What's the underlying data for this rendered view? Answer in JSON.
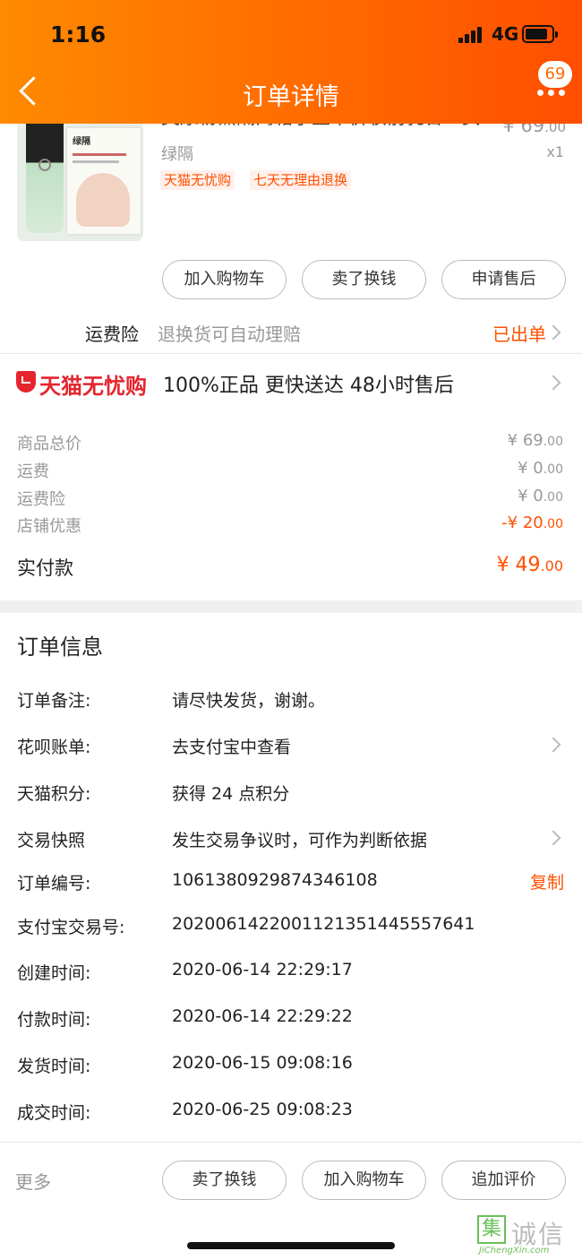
{
  "status_bar": {
    "time": "1:16",
    "network": "4G"
  },
  "header": {
    "title": "订单详情",
    "badge_count": "69"
  },
  "product": {
    "name": "美康粉黛隔离霜学生平价妆前乳合一女",
    "price_symbol": "¥",
    "price_int": "69",
    "price_dec": ".00",
    "sku": "绿隔",
    "qty": "x1",
    "tags": [
      "天猫无忧购",
      "七天无理由退换"
    ],
    "image_label": "绿隔"
  },
  "product_actions": [
    "加入购物车",
    "卖了换钱",
    "申请售后"
  ],
  "shipping_insurance": {
    "label": "运费险",
    "desc": "退换货可自动理赔",
    "status": "已出单"
  },
  "tmall_guarantee": {
    "brand": "天猫无忧购",
    "promise": "100%正品  更快送达  48小时售后"
  },
  "fees": [
    {
      "label": "商品总价",
      "value": "¥ 69",
      "dec": ".00",
      "highlight": false
    },
    {
      "label": "运费",
      "value": "¥ 0",
      "dec": ".00",
      "highlight": false
    },
    {
      "label": "运费险",
      "value": "¥ 0",
      "dec": ".00",
      "highlight": false
    },
    {
      "label": "店铺优惠",
      "value": "-¥ 20",
      "dec": ".00",
      "highlight": true
    }
  ],
  "actual_paid": {
    "label": "实付款",
    "value": "¥ 49",
    "dec": ".00"
  },
  "order_info": {
    "title": "订单信息",
    "rows": [
      {
        "label": "订单备注:",
        "value": "请尽快发货，谢谢。"
      },
      {
        "label": "花呗账单:",
        "value": "去支付宝中查看"
      },
      {
        "label": "天猫积分:",
        "value": "获得 24 点积分"
      },
      {
        "label": "交易快照",
        "value": "发生交易争议时，可作为判断依据"
      },
      {
        "label": "订单编号:",
        "value": "1061380929874346108"
      },
      {
        "label": "支付宝交易号:",
        "value": "2020061422001121351445557641"
      },
      {
        "label": "创建时间:",
        "value": "2020-06-14 22:29:17"
      },
      {
        "label": "付款时间:",
        "value": "2020-06-14 22:29:22"
      },
      {
        "label": "发货时间:",
        "value": "2020-06-15 09:08:16"
      },
      {
        "label": "成交时间:",
        "value": "2020-06-25 09:08:23"
      }
    ],
    "copy_label": "复制"
  },
  "bottom_bar": {
    "more": "更多",
    "buttons": [
      "卖了换钱",
      "加入购物车",
      "追加评价"
    ]
  },
  "watermark": {
    "glyph": "集",
    "text": "诚信",
    "sub": "JiChengXin.com"
  },
  "colors": {
    "accent": "#ff5000",
    "header_start": "#ff8a00",
    "header_end": "#ff4e00",
    "tmall_red": "#e4252e"
  }
}
